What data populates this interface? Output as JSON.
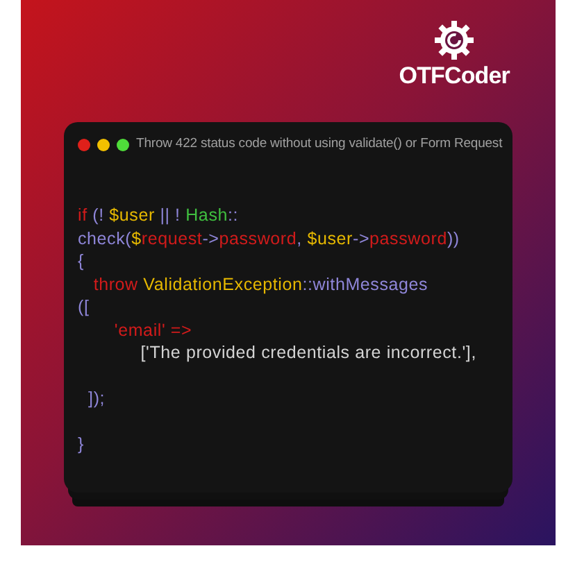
{
  "logo": {
    "text": "OTFCoder"
  },
  "window": {
    "title": "Throw 422 status code without using validate() or Form Request",
    "lines": [
      {
        "gap_before": false,
        "tokens": [
          {
            "kind": "keyword",
            "text": "if"
          },
          {
            "kind": "punct",
            "text": " (! "
          },
          {
            "kind": "variable",
            "text": "$user"
          },
          {
            "kind": "punct",
            "text": " || ! "
          },
          {
            "kind": "class",
            "text": "Hash"
          },
          {
            "kind": "punct",
            "text": "::"
          }
        ]
      },
      {
        "gap_before": false,
        "tokens": [
          {
            "kind": "punct",
            "text": "check("
          },
          {
            "kind": "variable",
            "text": "$"
          },
          {
            "kind": "keyword",
            "text": "request"
          },
          {
            "kind": "punct",
            "text": "->"
          },
          {
            "kind": "keyword",
            "text": "password"
          },
          {
            "kind": "punct",
            "text": ", "
          },
          {
            "kind": "variable",
            "text": "$user"
          },
          {
            "kind": "punct",
            "text": "->"
          },
          {
            "kind": "keyword",
            "text": "password"
          },
          {
            "kind": "punct",
            "text": "))"
          }
        ]
      },
      {
        "gap_before": false,
        "tokens": [
          {
            "kind": "punct",
            "text": "{"
          }
        ]
      },
      {
        "gap_before": false,
        "tokens": [
          {
            "kind": "keyword",
            "text": "   throw"
          },
          {
            "kind": "variable",
            "text": " ValidationException"
          },
          {
            "kind": "punct",
            "text": "::withMessages"
          }
        ]
      },
      {
        "gap_before": false,
        "tokens": [
          {
            "kind": "punct",
            "text": "(["
          }
        ]
      },
      {
        "gap_before": false,
        "tokens": [
          {
            "kind": "keyword",
            "text": "       'email' =>"
          }
        ]
      },
      {
        "gap_before": false,
        "tokens": [
          {
            "kind": "string",
            "text": "            ['The provided credentials are incorrect.'],"
          }
        ]
      },
      {
        "gap_before": true,
        "tokens": [
          {
            "kind": "punct",
            "text": "  ]);"
          }
        ]
      },
      {
        "gap_before": true,
        "tokens": [
          {
            "kind": "punct",
            "text": "}"
          }
        ]
      }
    ]
  }
}
